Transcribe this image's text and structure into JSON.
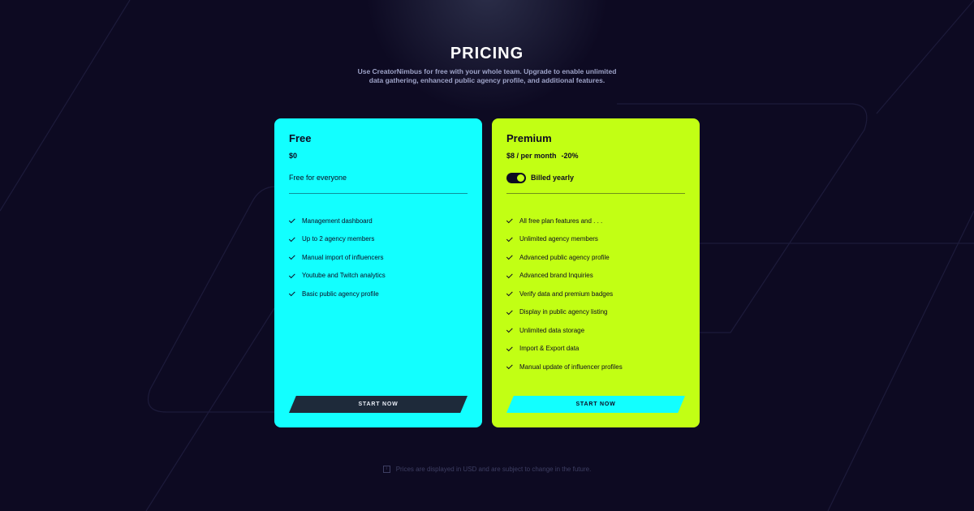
{
  "header": {
    "title": "PRICING",
    "subtitle": "Use CreatorNimbus for free with your whole team. Upgrade to enable unlimited data gathering, enhanced public agency profile, and additional features."
  },
  "plans": {
    "free": {
      "name": "Free",
      "price": "$0",
      "tagline": "Free for everyone",
      "features": [
        "Management dashboard",
        "Up to 2 agency members",
        "Manual import of influencers",
        "Youtube and Twitch analytics",
        "Basic public agency profile"
      ],
      "cta": "START NOW",
      "color": "#12ffff"
    },
    "premium": {
      "name": "Premium",
      "price": "$8 / per month",
      "discount": "-20%",
      "toggle_label": "Billed yearly",
      "toggle_on": true,
      "features": [
        "All free plan features and . . .",
        "Unlimited agency members",
        "Advanced public agency profile",
        "Advanced brand Inquiries",
        "Verify data and premium badges",
        "Display in public agency listing",
        "Unlimited data storage",
        "Import & Export data",
        "Manual update of influencer profiles"
      ],
      "cta": "START NOW",
      "color": "#c2ff14"
    }
  },
  "footnote": {
    "icon": "info-icon",
    "text": "Prices are displayed in USD and are subject to change in the future."
  },
  "colors": {
    "background": "#0d0a22",
    "cyan": "#12ffff",
    "lime": "#c2ff14",
    "dark_button": "#1e2a3a"
  }
}
